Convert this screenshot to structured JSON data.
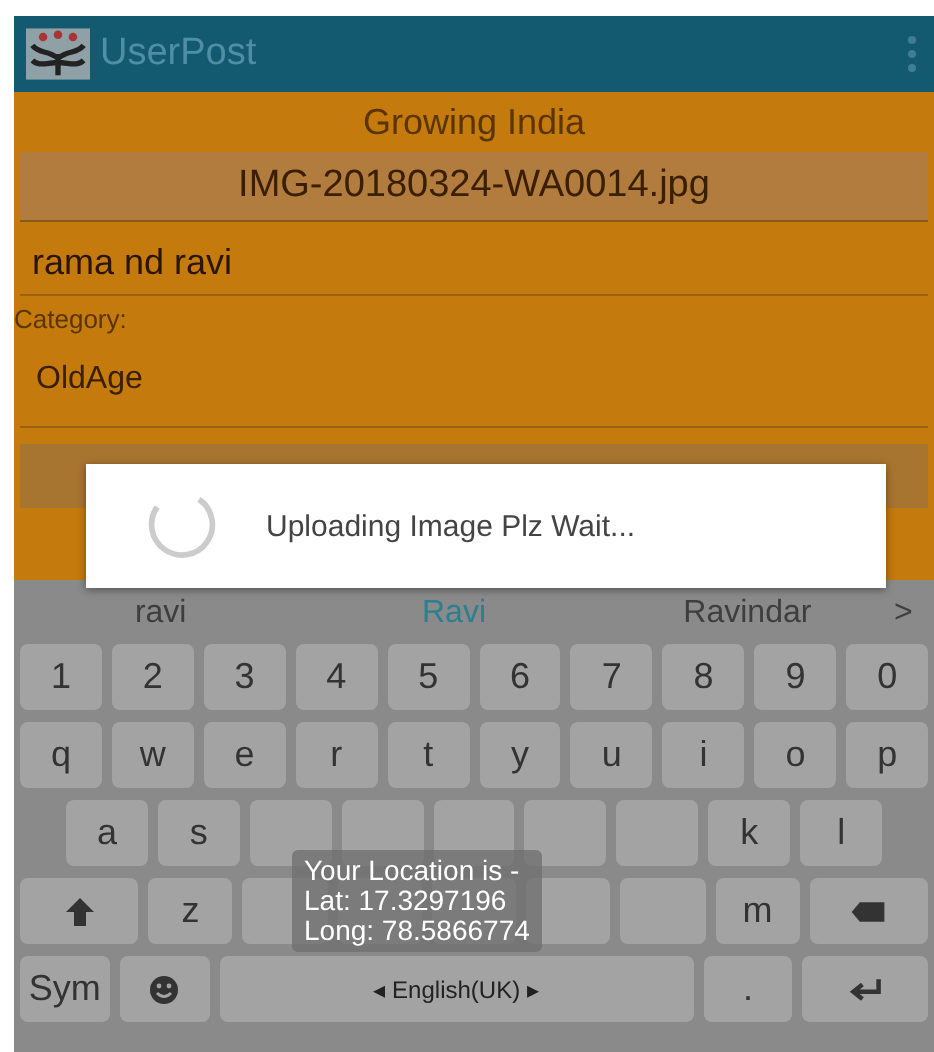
{
  "app_bar": {
    "title": "UserPost"
  },
  "form": {
    "heading": "Growing India",
    "file_name": "IMG-20180324-WA0014.jpg",
    "name_value": "rama nd ravi",
    "category_label": "Category:",
    "category_value": "OldAge"
  },
  "dialog": {
    "message": "Uploading Image Plz Wait..."
  },
  "suggestions": [
    {
      "text": "ravi",
      "selected": false
    },
    {
      "text": "Ravi",
      "selected": true
    },
    {
      "text": "Ravindar",
      "selected": false
    }
  ],
  "suggestions_more": ">",
  "keyboard": {
    "number_row": [
      {
        "kind": "char",
        "label": "1"
      },
      {
        "kind": "char",
        "label": "2"
      },
      {
        "kind": "char",
        "label": "3"
      },
      {
        "kind": "char",
        "label": "4"
      },
      {
        "kind": "char",
        "label": "5"
      },
      {
        "kind": "char",
        "label": "6"
      },
      {
        "kind": "char",
        "label": "7"
      },
      {
        "kind": "char",
        "label": "8"
      },
      {
        "kind": "char",
        "label": "9"
      },
      {
        "kind": "char",
        "label": "0"
      }
    ],
    "top_row": [
      {
        "kind": "char",
        "label": "q"
      },
      {
        "kind": "char",
        "label": "w"
      },
      {
        "kind": "char",
        "label": "e"
      },
      {
        "kind": "char",
        "label": "r"
      },
      {
        "kind": "char",
        "label": "t"
      },
      {
        "kind": "char",
        "label": "y"
      },
      {
        "kind": "char",
        "label": "u"
      },
      {
        "kind": "char",
        "label": "i"
      },
      {
        "kind": "char",
        "label": "o"
      },
      {
        "kind": "char",
        "label": "p"
      }
    ],
    "home_row": [
      {
        "kind": "char",
        "label": "a"
      },
      {
        "kind": "char",
        "label": "s"
      },
      {
        "kind": "covered"
      },
      {
        "kind": "covered"
      },
      {
        "kind": "covered"
      },
      {
        "kind": "covered"
      },
      {
        "kind": "covered"
      },
      {
        "kind": "char",
        "label": "k"
      },
      {
        "kind": "char",
        "label": "l"
      }
    ],
    "bottom_row": [
      {
        "kind": "shift"
      },
      {
        "kind": "char",
        "label": "z"
      },
      {
        "kind": "covered"
      },
      {
        "kind": "covered"
      },
      {
        "kind": "covered"
      },
      {
        "kind": "covered"
      },
      {
        "kind": "covered"
      },
      {
        "kind": "char",
        "label": "m"
      },
      {
        "kind": "backspace"
      }
    ],
    "space_row": [
      {
        "kind": "char",
        "label": "Sym"
      },
      {
        "kind": "emoji"
      },
      {
        "kind": "space",
        "label": "◂ English(UK) ▸"
      },
      {
        "kind": "char",
        "label": "."
      },
      {
        "kind": "enter"
      }
    ]
  },
  "toast": {
    "lines": [
      "Your Location is -",
      "Lat: 17.3297196",
      "Long: 78.5866774"
    ]
  }
}
